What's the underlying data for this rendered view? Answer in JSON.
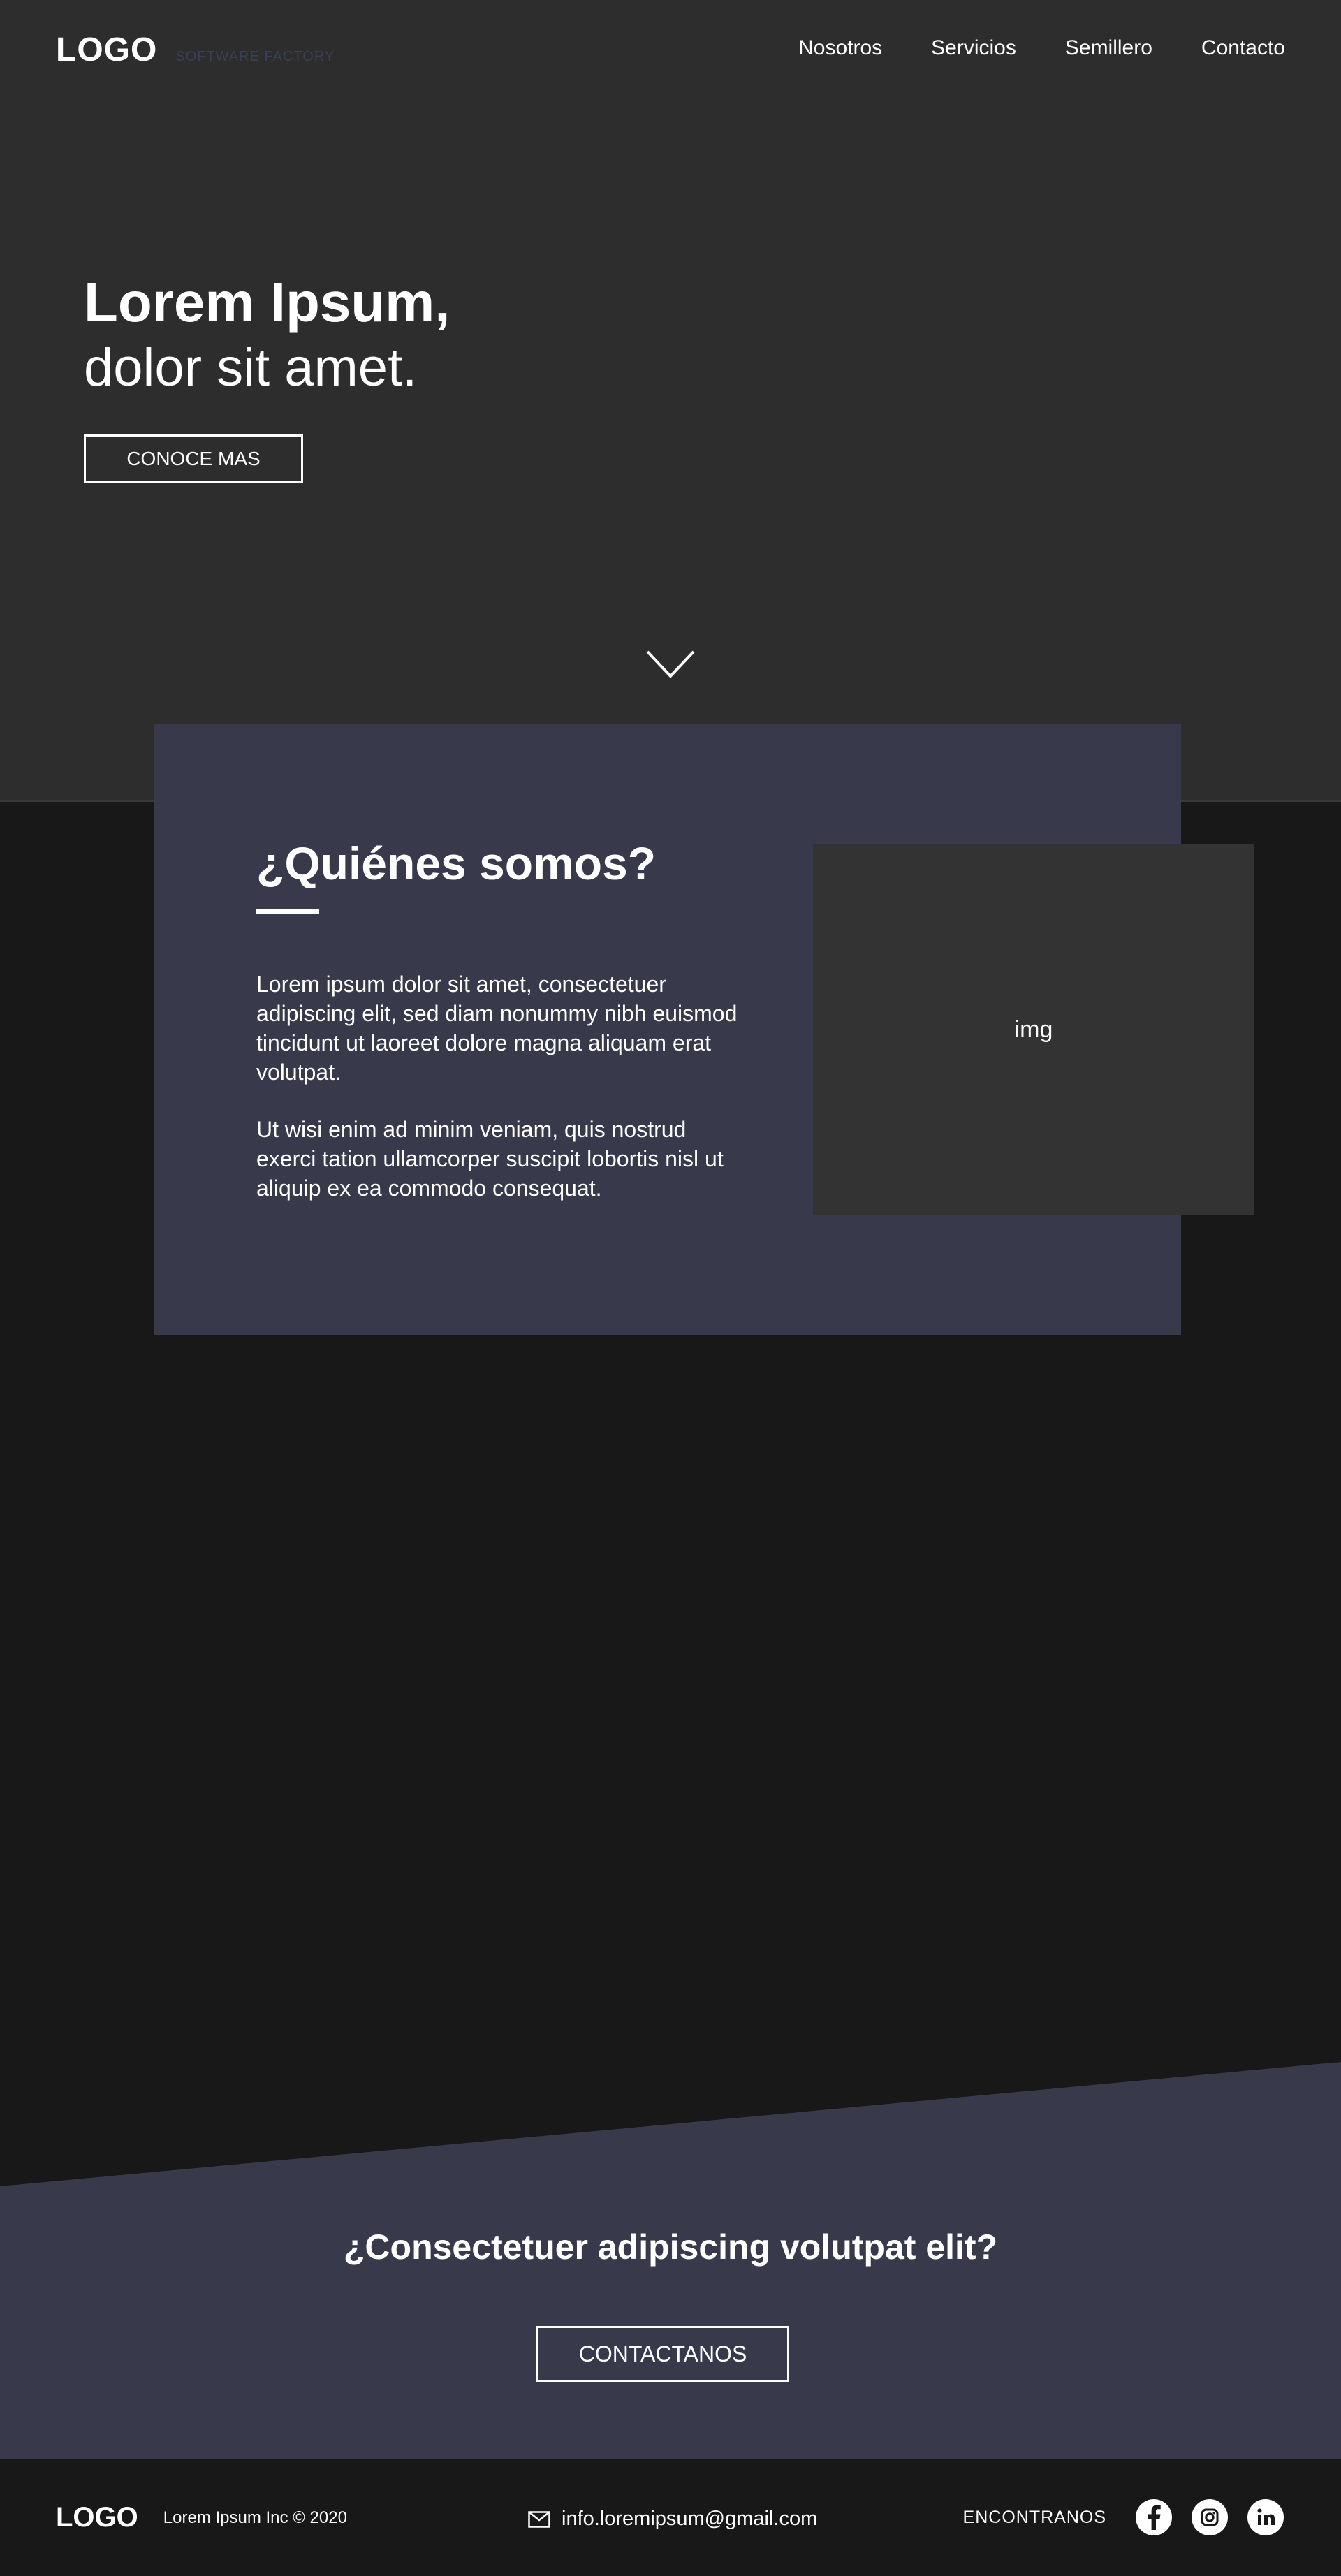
{
  "header": {
    "logo": "LOGO",
    "tagline": "SOFTWARE FACTORY",
    "nav": [
      {
        "label": "Nosotros"
      },
      {
        "label": "Servicios"
      },
      {
        "label": "Semillero"
      },
      {
        "label": "Contacto"
      }
    ]
  },
  "hero": {
    "title": "Lorem Ipsum,",
    "subtitle": "dolor sit amet.",
    "button_label": "CONOCE MAS",
    "scroll_icon": "chevron-down-icon"
  },
  "about": {
    "title": "¿Quiénes somos?",
    "paragraphs": [
      "Lorem ipsum dolor sit amet, consectetuer adipiscing elit, sed diam nonummy nibh euismod tincidunt ut laoreet dolore magna aliquam erat volutpat.",
      "Ut wisi enim ad minim veniam, quis nostrud exerci tation ullamcorper suscipit lobortis nisl ut aliquip ex ea commodo consequat."
    ],
    "image_placeholder": "img"
  },
  "cta": {
    "title": "¿Consectetuer adipiscing  volutpat elit?",
    "button_label": "CONTACTANOS"
  },
  "footer": {
    "logo": "LOGO",
    "copyright": "Lorem Ipsum Inc © 2020",
    "email": "info.loremipsum@gmail.com",
    "email_icon": "mail-icon",
    "social_label": "ENCONTRANOS",
    "social": [
      "facebook-icon",
      "instagram-icon",
      "linkedin-icon"
    ]
  },
  "colors": {
    "hero_bg": "#2d2d2d",
    "page_bg": "#181818",
    "accent_panel": "#383a4c",
    "image_placeholder_bg": "#333333",
    "text": "#ffffff"
  }
}
